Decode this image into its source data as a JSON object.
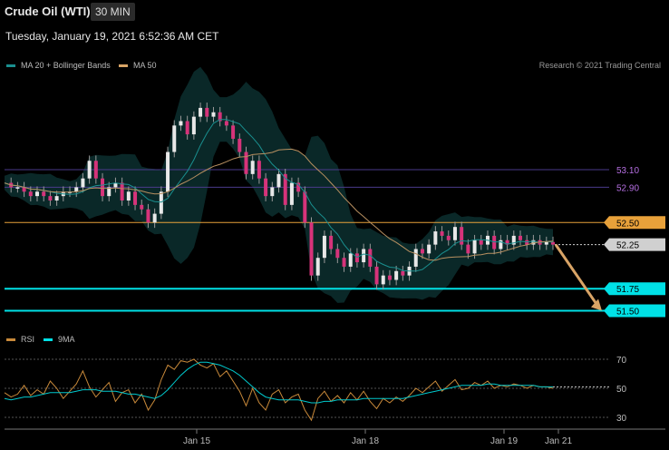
{
  "header": {
    "title": "Crude Oil (WTI)",
    "timeframe": "30 MIN",
    "datetime": "Tuesday, January 19, 2021 6:52:36 AM CET"
  },
  "legend": {
    "main": [
      {
        "label": "MA 20 + Bollinger Bands",
        "color": "#1a8f8f"
      },
      {
        "label": "MA 50",
        "color": "#d9a466"
      }
    ],
    "rsi": [
      {
        "label": "RSI",
        "color": "#c8893a"
      },
      {
        "label": "9MA",
        "color": "#00e1e6"
      }
    ],
    "credit": "Research © 2021 Trading Central"
  },
  "chart_data": {
    "type": "line",
    "price_panel": {
      "ylim": [
        51.3,
        54.2
      ],
      "levels": [
        {
          "value": 53.1,
          "label": "53.10",
          "kind": "resistance-line",
          "color": "#4a3a8a",
          "text_color": "#b46ee0"
        },
        {
          "value": 52.9,
          "label": "52.90",
          "kind": "resistance-line",
          "color": "#4a3a8a",
          "text_color": "#b46ee0"
        },
        {
          "value": 52.5,
          "label": "52.50",
          "kind": "pivot",
          "color": "#e8a13a",
          "text_color": "#000000"
        },
        {
          "value": 52.25,
          "label": "52.25",
          "kind": "last-price",
          "color": "#d0d0d0",
          "text_color": "#000000"
        },
        {
          "value": 51.75,
          "label": "51.75",
          "kind": "target",
          "color": "#00e1e6",
          "text_color": "#000000"
        },
        {
          "value": 51.5,
          "label": "51.50",
          "kind": "target",
          "color": "#00e1e6",
          "text_color": "#000000"
        }
      ],
      "close_path": [
        52.95,
        52.9,
        52.9,
        52.85,
        52.8,
        52.85,
        52.8,
        52.75,
        52.8,
        52.85,
        52.85,
        52.9,
        53.0,
        53.2,
        53.0,
        52.8,
        52.9,
        52.95,
        52.75,
        52.85,
        52.7,
        52.65,
        52.5,
        52.6,
        52.85,
        53.3,
        53.6,
        53.65,
        53.5,
        53.7,
        53.8,
        53.7,
        53.75,
        53.65,
        53.6,
        53.45,
        53.3,
        53.05,
        53.2,
        53.0,
        52.8,
        52.9,
        53.05,
        52.7,
        52.95,
        52.85,
        52.5,
        51.9,
        52.1,
        52.35,
        52.2,
        52.1,
        52.0,
        52.15,
        52.05,
        52.2,
        52.0,
        51.8,
        51.9,
        51.85,
        51.95,
        51.9,
        52.0,
        52.2,
        52.15,
        52.25,
        52.4,
        52.35,
        52.3,
        52.45,
        52.25,
        52.15,
        52.3,
        52.25,
        52.35,
        52.2,
        52.3,
        52.25,
        52.35,
        52.3,
        52.25,
        52.3,
        52.25,
        52.28,
        52.25
      ],
      "projection": {
        "from": 52.25,
        "to": 51.5
      }
    },
    "rsi_panel": {
      "ylim": [
        25,
        75
      ],
      "levels": [
        70,
        50,
        30
      ],
      "rsi": [
        47,
        44,
        46,
        52,
        45,
        49,
        46,
        55,
        50,
        43,
        48,
        53,
        62,
        51,
        44,
        49,
        54,
        41,
        47,
        49,
        40,
        46,
        35,
        42,
        56,
        66,
        63,
        69,
        68,
        70,
        66,
        64,
        67,
        58,
        62,
        55,
        48,
        38,
        50,
        40,
        35,
        46,
        49,
        40,
        44,
        46,
        35,
        28,
        43,
        48,
        41,
        45,
        40,
        47,
        42,
        48,
        41,
        36,
        43,
        40,
        44,
        41,
        45,
        50,
        47,
        51,
        55,
        48,
        52,
        56,
        49,
        50,
        54,
        52,
        55,
        50,
        52,
        51,
        53,
        52,
        50,
        52,
        51,
        51,
        50
      ],
      "ma9": [
        43,
        42,
        43,
        44,
        44,
        45,
        46,
        47,
        47,
        47,
        47,
        48,
        49,
        49,
        49,
        48,
        48,
        48,
        47,
        46,
        46,
        45,
        44,
        43,
        45,
        49,
        54,
        59,
        63,
        66,
        68,
        68,
        67,
        66,
        64,
        62,
        59,
        55,
        51,
        47,
        44,
        43,
        42,
        42,
        42,
        42,
        41,
        40,
        40,
        41,
        41,
        42,
        42,
        42,
        42,
        43,
        43,
        43,
        43,
        43,
        43,
        43,
        44,
        45,
        46,
        47,
        48,
        49,
        50,
        51,
        52,
        52,
        52,
        52,
        53,
        53,
        52,
        52,
        52,
        52,
        52,
        52,
        51,
        51,
        51
      ],
      "tick_labels": [
        "70",
        "50",
        "30"
      ]
    },
    "x_tick_labels": [
      "Jan 15",
      "Jan 18",
      "Jan 19",
      "Jan 21"
    ]
  }
}
